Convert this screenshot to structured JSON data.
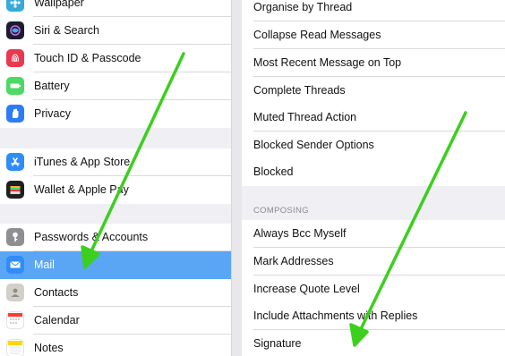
{
  "settings_sidebar": {
    "group1": [
      {
        "label": "Wallpaper",
        "icon": "wallpaper-icon",
        "color": "#36aadc"
      },
      {
        "label": "Siri & Search",
        "icon": "siri-icon",
        "color": "#1c1c2e"
      },
      {
        "label": "Touch ID & Passcode",
        "icon": "fingerprint-icon",
        "color": "#e9384f"
      },
      {
        "label": "Battery",
        "icon": "battery-icon",
        "color": "#4cd964"
      },
      {
        "label": "Privacy",
        "icon": "privacy-hand-icon",
        "color": "#2c7cf6"
      }
    ],
    "group2": [
      {
        "label": "iTunes & App Store",
        "icon": "app-store-icon",
        "color": "#2f8cf8"
      },
      {
        "label": "Wallet & Apple Pay",
        "icon": "wallet-icon",
        "color": "#1f1f1f"
      }
    ],
    "group3": [
      {
        "label": "Passwords & Accounts",
        "icon": "key-icon",
        "color": "#8e8e93"
      },
      {
        "label": "Mail",
        "icon": "mail-icon",
        "color": "#2f8cf8",
        "selected": true
      },
      {
        "label": "Contacts",
        "icon": "contacts-icon",
        "color": "#d3d0c9"
      },
      {
        "label": "Calendar",
        "icon": "calendar-icon",
        "color": "#ffffff"
      },
      {
        "label": "Notes",
        "icon": "notes-icon",
        "color": "#ffd60a"
      }
    ]
  },
  "mail_settings": {
    "threading_rows": [
      "Organise by Thread",
      "Collapse Read Messages",
      "Most Recent Message on Top",
      "Complete Threads",
      "Muted Thread Action",
      "Blocked Sender Options",
      "Blocked"
    ],
    "composing_header": "COMPOSING",
    "composing_rows": [
      "Always Bcc Myself",
      "Mark Addresses",
      "Increase Quote Level",
      "Include Attachments with Replies",
      "Signature"
    ]
  },
  "annotation_color": "#3ccf1e"
}
